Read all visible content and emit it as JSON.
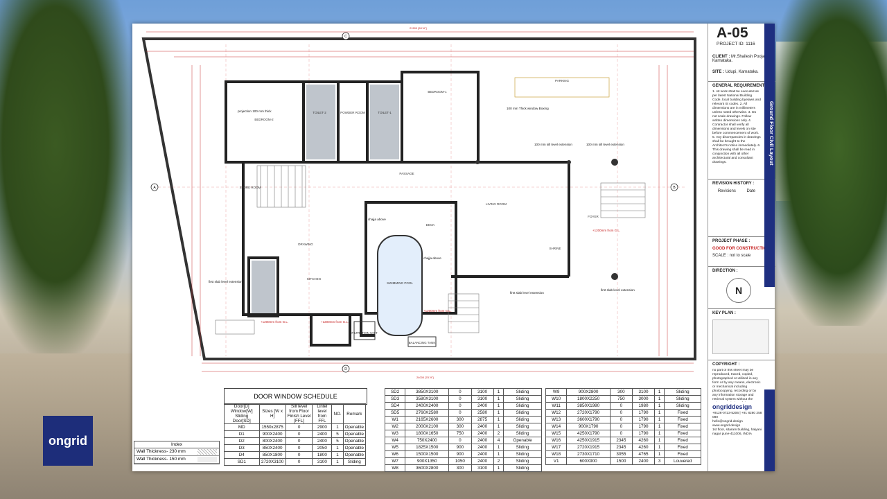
{
  "brand_logo_text": "ongrid",
  "title_block": {
    "sheet_no": "A-05",
    "project_id": "PROJECT ID: 1116",
    "client_label": "CLIENT :",
    "client_value": "Mr.Shailesh Poojari, Karnataka.",
    "site_label": "SITE :",
    "site_value": "Udupi, Karnataka.",
    "general_req_title": "GENERAL REQUIREMENTS :",
    "general_req_notes": "1. All work shall be executed as per latest National Building Code, local building byelaws and relevant IS codes. 2. All dimensions are in millimeters unless noted otherwise. 3. Do not scale drawings. Follow written dimensions only. 4. Contractor shall verify all dimensions and levels on site before commencement of work. 5. Any discrepancies in drawings shall be brought to the Architect's notice immediately. 6. This drawing shall be read in conjunction with all other architectural and consultant drawings.",
    "drawing_title": "Ground Floor Civil Layout",
    "revision_title": "REVISION HISTORY :",
    "revision_col1": "Revisions",
    "revision_col2": "Date",
    "phase_label": "PROJECT PHASE :",
    "phase_value": "GOOD FOR CONSTRUCTION",
    "scale_label": "SCALE :",
    "scale_value": "not to scale",
    "direction_label": "DIRECTION :",
    "direction_letter": "N",
    "keyplan_label": "KEY PLAN :",
    "copyright_label": "COPYRIGHT :",
    "copyright_text": "no part of this sheet may be reproduced, traced, copied, photographed or utilized in any form or by any means, electronic or mechanical including photocopying, recording or by any information storage and retrieval system without the written permission of the Architect.",
    "firm_name": "ongriddesign",
    "firm_phone": "+9126-0723-5206 | +91 8280 258 080",
    "firm_email": "hello@ongrid.design",
    "firm_web": "www.ongrid.design",
    "firm_address": "1st floor, sitaram building, halyani nagar pune-411006, INDIA"
  },
  "plan_labels": {
    "bedroom1": "BEDROOM-2",
    "bedroom2": "BEDROOM-1",
    "toilet1": "TOILET-2",
    "powder": "POWDER ROOM",
    "toilet2": "TOILET-1",
    "passage": "PASSAGE",
    "living": "LIVING ROOM",
    "deck": "DECK",
    "drawing": "DRAWING",
    "kitchen": "KITCHEN",
    "pool": "SWIMMING POOL",
    "foyer": "FOYER",
    "parking": "PARKING",
    "shrine": "SHRINE",
    "filtration": "FILTRATION UNIT",
    "balancing": "BALANCING TANK",
    "store": "STORE ROOM",
    "projection": "projection 100 mm thick",
    "window_boxing": "100 mm Thick window Boxing",
    "sill_ext1": "100 mm sill level extension",
    "sill_ext2": "100 mm sill level extension",
    "first_slab1": "first slab level extension",
    "first_slab2": "first slab level extension",
    "first_slab3": "first slab level extension",
    "chajja1": "chajja above",
    "chajja2": "chajja above",
    "lvl1": "+1200mm from G.L.",
    "lvl2": "+1200mm from G.L.",
    "lvl3": "+1200mm from G.L.",
    "lvl4": "+1200mm from G.L.",
    "top_dim": "21500 [69'-6\"]",
    "bottom_dim": "24000 [78'-9\"]",
    "grid_a": "A",
    "grid_b": "B",
    "grid_c": "C",
    "grid_d": "D"
  },
  "schedule": {
    "title": "DOOR WINDOW SCHEDULE",
    "headers": [
      "Door[D] Window[W] Sliding Door[SD]",
      "Sizes [W x H]",
      "Sill level from Floor Finish Level [FFL]",
      "Lintel level from FFL",
      "NO.",
      "Remark"
    ],
    "table1": [
      [
        "MD",
        "1550x2875",
        "0",
        "2900",
        "1",
        "Openable"
      ],
      [
        "D1",
        "900X2400",
        "0",
        "2400",
        "5",
        "Openable"
      ],
      [
        "D2",
        "800X2400",
        "0",
        "2400",
        "5",
        "Openable"
      ],
      [
        "D3",
        "850X2400",
        "0",
        "2050",
        "1",
        "Openable"
      ],
      [
        "D4",
        "850X1800",
        "0",
        "1800",
        "1",
        "Openable"
      ],
      [
        "SD1",
        "2720X3100",
        "0",
        "3100",
        "1",
        "Sliding"
      ]
    ],
    "table2": [
      [
        "SD2",
        "3850X3100",
        "0",
        "3100",
        "1",
        "Sliding"
      ],
      [
        "SD3",
        "3580X3100",
        "0",
        "3100",
        "1",
        "Sliding"
      ],
      [
        "SD4",
        "2400X2400",
        "0",
        "2400",
        "1",
        "Sliding"
      ],
      [
        "SD5",
        "2760X2580",
        "0",
        "2580",
        "1",
        "Sliding"
      ],
      [
        "W1",
        "2165X2600",
        "300",
        "2875",
        "1",
        "Sliding"
      ],
      [
        "W2",
        "2000X2100",
        "300",
        "2400",
        "1",
        "Sliding"
      ],
      [
        "W3",
        "1800X1650",
        "750",
        "2400",
        "2",
        "Sliding"
      ],
      [
        "W4",
        "750X2400",
        "0",
        "2400",
        "4",
        "Openable"
      ],
      [
        "W5",
        "1825X1500",
        "900",
        "2400",
        "1",
        "Sliding"
      ],
      [
        "W6",
        "1500X1500",
        "900",
        "2400",
        "1",
        "Sliding"
      ],
      [
        "W7",
        "900X1350",
        "1050",
        "2400",
        "2",
        "Sliding"
      ],
      [
        "W8",
        "3600X2800",
        "300",
        "3100",
        "1",
        "Sliding"
      ]
    ],
    "table3": [
      [
        "W9",
        "900X2800",
        "300",
        "3100",
        "1",
        "Sliding"
      ],
      [
        "W10",
        "1800X2250",
        "750",
        "3000",
        "1",
        "Sliding"
      ],
      [
        "W11",
        "3850X1980",
        "0",
        "1980",
        "1",
        "Sliding"
      ],
      [
        "W12",
        "2720X1790",
        "0",
        "1790",
        "1",
        "Fixed"
      ],
      [
        "W13",
        "3600X1790",
        "0",
        "1790",
        "1",
        "Fixed"
      ],
      [
        "W14",
        "900X1790",
        "0",
        "1790",
        "1",
        "Fixed"
      ],
      [
        "W15",
        "4250X1790",
        "0",
        "1790",
        "1",
        "Fixed"
      ],
      [
        "W16",
        "4250X1915",
        "2345",
        "4260",
        "1",
        "Fixed"
      ],
      [
        "W17",
        "2720X1915",
        "2345",
        "4260",
        "1",
        "Fixed"
      ],
      [
        "W18",
        "2730X1710",
        "3055",
        "4765",
        "1",
        "Fixed"
      ],
      [
        "V1",
        "600X900",
        "1500",
        "2400",
        "3",
        "Louvered"
      ]
    ]
  },
  "index": {
    "title": "Index",
    "row1": "Wall Thickness- 230 mm",
    "row2": "Wall Thickness- 150 mm"
  }
}
